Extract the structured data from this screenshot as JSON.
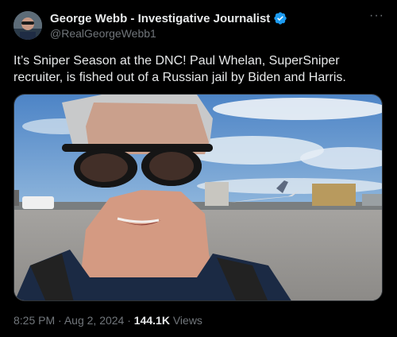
{
  "author": {
    "name": "George Webb - Investigative Journalist",
    "handle": "@RealGeorgeWebb1",
    "verified_icon": "verified-badge-icon",
    "verified_color": "#1d9bf0"
  },
  "more_icon": "more-options-icon",
  "tweet": {
    "text": "It’s Sniper Season at the DNC! Paul Whelan, SuperSniper recruiter, is fished out of a Russian jail by Biden and Harris."
  },
  "media": {
    "type": "video",
    "description_icon": "video-thumbnail"
  },
  "meta": {
    "time": "8:25 PM",
    "separator": "·",
    "date": "Aug 2, 2024",
    "views_count": "144.1K",
    "views_label": "Views"
  },
  "colors": {
    "background": "#000000",
    "text": "#e7e9ea",
    "secondary": "#71767b"
  }
}
